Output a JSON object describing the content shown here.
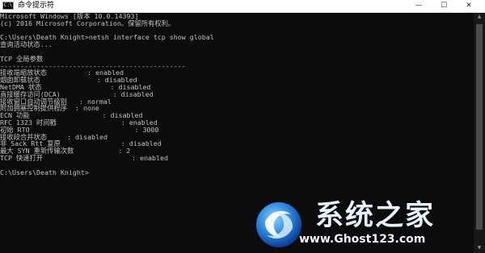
{
  "window": {
    "title": "命令提示符",
    "icon": "cmd-icon",
    "controls": {
      "minimize": "—",
      "maximize": "☐",
      "close": "✕"
    }
  },
  "console": {
    "lines": [
      "Microsoft Windows [版本 10.0.14393]",
      "(c) 2016 Microsoft Corporation。保留所有权利。",
      "",
      "C:\\Users\\Death Knight>netsh interface tcp show global",
      "查询活动状态...",
      "",
      "TCP 全局参数",
      "----------------------------------------------",
      "接收端缩放状态          : enabled",
      "烟囱卸载状态              : disabled",
      "NetDMA 状态                 : disabled",
      "直接缓存访问(DCA)             : disabled",
      "接收窗口自动调节级别   : normal",
      "附加拥塞控制提供程序  : none",
      "ECN 功能                  : disabled",
      "RFC 1323 时间戳                : enabled",
      "初始 RTO                          : 3000",
      "接收段合并状态     : disabled",
      "非 Sack Rtt 复原               : disabled",
      "最大 SYN 重新传输次数           : 2",
      "TCP 快速打开                      : enabled",
      "",
      "C:\\Users\\Death Knight>"
    ]
  },
  "watermark": {
    "name": "系统之家",
    "url": "www.Ghost123.com"
  }
}
